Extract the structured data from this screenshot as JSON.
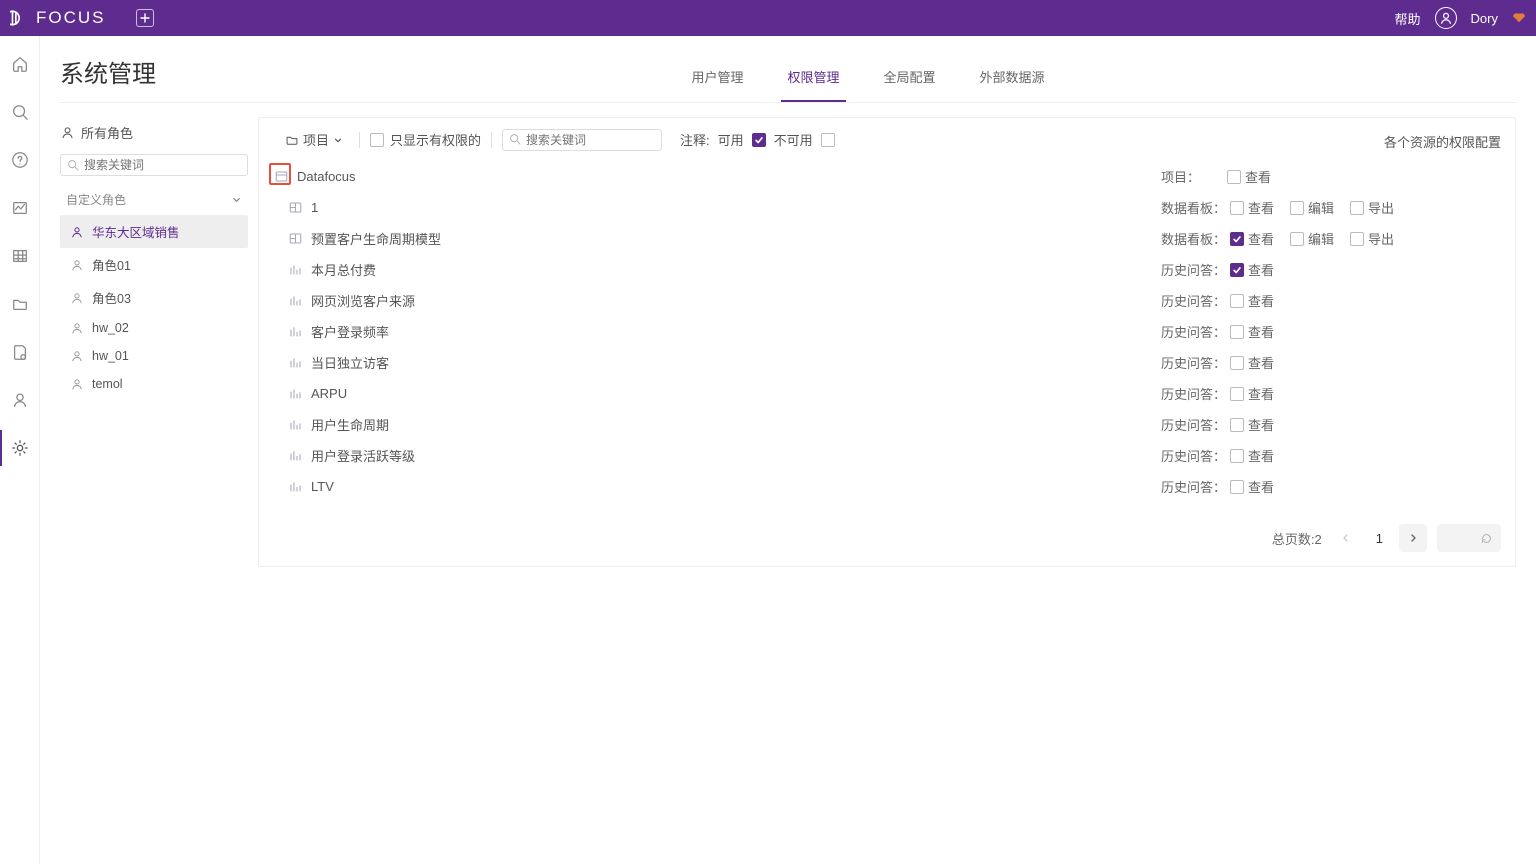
{
  "header": {
    "brand": "FOCUS",
    "help": "帮助",
    "username": "Dory"
  },
  "page": {
    "title": "系统管理"
  },
  "tabs": [
    "用户管理",
    "权限管理",
    "全局配置",
    "外部数据源"
  ],
  "tabs_active_index": 1,
  "sidebar": {
    "all_roles": "所有角色",
    "search_placeholder": "搜索关键词",
    "group_label": "自定义角色",
    "roles": [
      "华东大区域销售",
      "角色01",
      "角色03",
      "hw_02",
      "hw_01",
      "temol"
    ],
    "selected_index": 0
  },
  "filters": {
    "project_label": "项目",
    "only_perm_label": "只显示有权限的",
    "only_perm_checked": false,
    "search_placeholder": "搜索关键词",
    "legend_label": "注释:",
    "usable_label": "可用",
    "usable_checked": true,
    "unusable_label": "不可用",
    "unusable_checked": false
  },
  "panel_title_right": "各个资源的权限配置",
  "resources": [
    {
      "icon": "project",
      "name": "Datafocus",
      "indent": false,
      "highlight": true,
      "perm": {
        "label": "项目：",
        "opts": [
          {
            "label": "查看",
            "checked": false
          }
        ]
      }
    },
    {
      "icon": "board",
      "name": "1",
      "indent": true,
      "perm": {
        "label": "数据看板：",
        "opts": [
          {
            "label": "查看",
            "checked": false
          },
          {
            "label": "编辑",
            "checked": false
          },
          {
            "label": "导出",
            "checked": false
          }
        ]
      }
    },
    {
      "icon": "board",
      "name": "预置客户生命周期模型",
      "indent": true,
      "perm": {
        "label": "数据看板：",
        "opts": [
          {
            "label": "查看",
            "checked": true
          },
          {
            "label": "编辑",
            "checked": false
          },
          {
            "label": "导出",
            "checked": false
          }
        ]
      }
    },
    {
      "icon": "chart",
      "name": "本月总付费",
      "indent": true,
      "perm": {
        "label": "历史问答：",
        "opts": [
          {
            "label": "查看",
            "checked": true
          }
        ]
      }
    },
    {
      "icon": "chart",
      "name": "网页浏览客户来源",
      "indent": true,
      "perm": {
        "label": "历史问答：",
        "opts": [
          {
            "label": "查看",
            "checked": false
          }
        ]
      }
    },
    {
      "icon": "chart",
      "name": "客户登录频率",
      "indent": true,
      "perm": {
        "label": "历史问答：",
        "opts": [
          {
            "label": "查看",
            "checked": false
          }
        ]
      }
    },
    {
      "icon": "chart",
      "name": "当日独立访客",
      "indent": true,
      "perm": {
        "label": "历史问答：",
        "opts": [
          {
            "label": "查看",
            "checked": false
          }
        ]
      }
    },
    {
      "icon": "chart",
      "name": "ARPU",
      "indent": true,
      "perm": {
        "label": "历史问答：",
        "opts": [
          {
            "label": "查看",
            "checked": false
          }
        ]
      }
    },
    {
      "icon": "chart",
      "name": "用户生命周期",
      "indent": true,
      "perm": {
        "label": "历史问答：",
        "opts": [
          {
            "label": "查看",
            "checked": false
          }
        ]
      }
    },
    {
      "icon": "chart",
      "name": "用户登录活跃等级",
      "indent": true,
      "perm": {
        "label": "历史问答：",
        "opts": [
          {
            "label": "查看",
            "checked": false
          }
        ]
      }
    },
    {
      "icon": "chart",
      "name": "LTV",
      "indent": true,
      "perm": {
        "label": "历史问答：",
        "opts": [
          {
            "label": "查看",
            "checked": false
          }
        ]
      }
    }
  ],
  "pager": {
    "total_label": "总页数:2",
    "current": "1"
  }
}
